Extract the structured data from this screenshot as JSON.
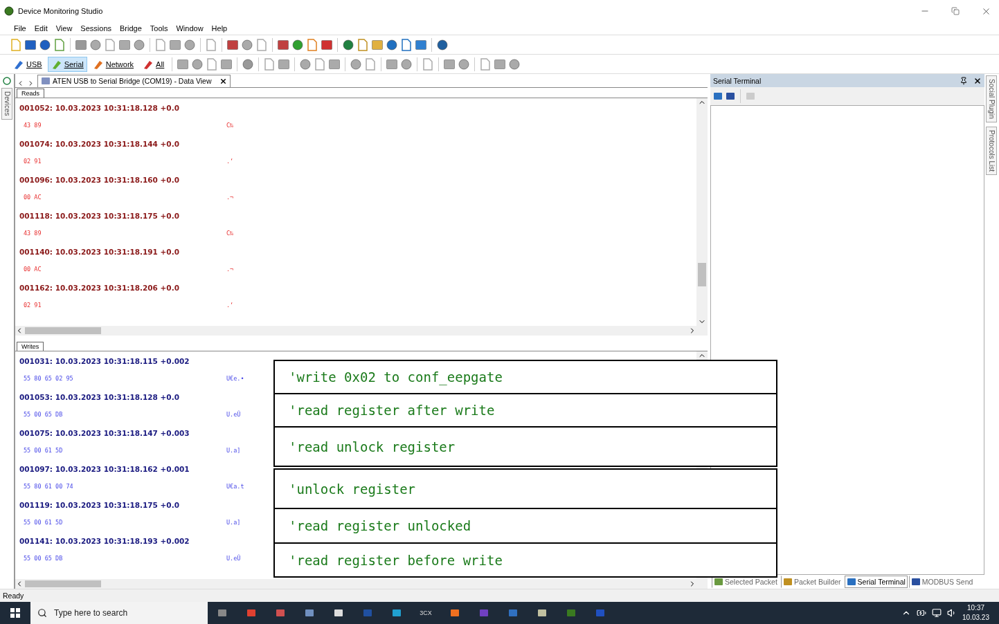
{
  "window": {
    "title": "Device Monitoring Studio"
  },
  "menu": [
    "File",
    "Edit",
    "View",
    "Sessions",
    "Bridge",
    "Tools",
    "Window",
    "Help"
  ],
  "device_filters": [
    {
      "label": "USB",
      "selected": false
    },
    {
      "label": "Serial",
      "selected": true
    },
    {
      "label": "Network",
      "selected": false
    },
    {
      "label": "All",
      "selected": false
    }
  ],
  "left_tabs": [
    "Devices"
  ],
  "document_tab": {
    "title": "ATEN USB to Serial Bridge (COM19) - Data View"
  },
  "reads": {
    "tab": "Reads",
    "packets": [
      {
        "header": "001052: 10.03.2023 10:31:18.128 +0.0",
        "hex": "43 89",
        "ascii": "C‰"
      },
      {
        "header": "001074: 10.03.2023 10:31:18.144 +0.0",
        "hex": "02 91",
        "ascii": ".‘"
      },
      {
        "header": "001096: 10.03.2023 10:31:18.160 +0.0",
        "hex": "00 AC",
        "ascii": ".¬"
      },
      {
        "header": "001118: 10.03.2023 10:31:18.175 +0.0",
        "hex": "43 89",
        "ascii": "C‰"
      },
      {
        "header": "001140: 10.03.2023 10:31:18.191 +0.0",
        "hex": "00 AC",
        "ascii": ".¬"
      },
      {
        "header": "001162: 10.03.2023 10:31:18.206 +0.0",
        "hex": "02 91",
        "ascii": ".‘"
      }
    ]
  },
  "writes": {
    "tab": "Writes",
    "packets": [
      {
        "header": "001031: 10.03.2023 10:31:18.115 +0.002",
        "hex": "55 80 65 02 95",
        "ascii": "U€e.•"
      },
      {
        "header": "001053: 10.03.2023 10:31:18.128 +0.0",
        "hex": "55 00 65 DB",
        "ascii": "U.eÛ"
      },
      {
        "header": "001075: 10.03.2023 10:31:18.147 +0.003",
        "hex": "55 00 61 5D",
        "ascii": "U.a]"
      },
      {
        "header": "001097: 10.03.2023 10:31:18.162 +0.001",
        "hex": "55 80 61 00 74",
        "ascii": "U€a.t"
      },
      {
        "header": "001119: 10.03.2023 10:31:18.175 +0.0",
        "hex": "55 00 61 5D",
        "ascii": "U.a]"
      },
      {
        "header": "001141: 10.03.2023 10:31:18.193 +0.002",
        "hex": "55 00 65 DB",
        "ascii": "U.eÛ"
      }
    ]
  },
  "side_panel": {
    "title": "Serial Terminal"
  },
  "right_tabs": [
    "Social Plugin",
    "Protocols List"
  ],
  "panel_tabs": [
    {
      "label": "Selected Packet",
      "selected": false
    },
    {
      "label": "Packet Builder",
      "selected": false
    },
    {
      "label": "Serial Terminal",
      "selected": true
    },
    {
      "label": "MODBUS Send",
      "selected": false
    }
  ],
  "status_bar": {
    "text": "Ready"
  },
  "comment_boxes": [
    {
      "lines": [
        "'write 0x02 to conf_eepgate",
        "'read register after write",
        "'read unlock register"
      ]
    },
    {
      "lines": [
        "'unlock register",
        "'read register unlocked",
        "'read register before write"
      ]
    }
  ],
  "taskbar": {
    "search": {
      "placeholder": "Type here to search"
    },
    "app_icon_text": "3CX",
    "time": "10:37",
    "date": "10.03.23"
  }
}
